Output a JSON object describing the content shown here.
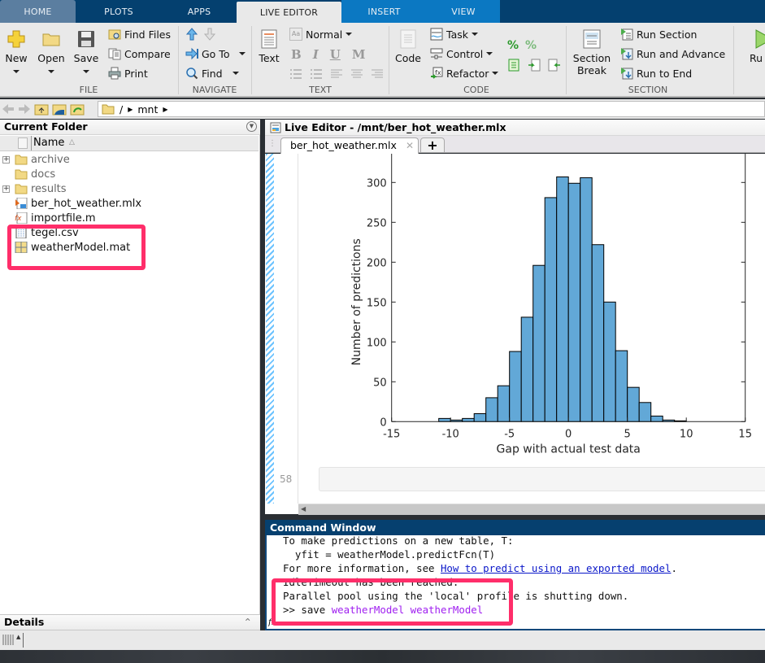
{
  "ribbon": {
    "tabs": [
      {
        "label": "HOME",
        "state": "inactive"
      },
      {
        "label": "PLOTS",
        "state": "inactive"
      },
      {
        "label": "APPS",
        "state": "inactive"
      },
      {
        "label": "LIVE EDITOR",
        "state": "active"
      },
      {
        "label": "INSERT",
        "state": "inactive"
      },
      {
        "label": "VIEW",
        "state": "inactive"
      }
    ],
    "file": {
      "group_label": "FILE",
      "new_label": "New",
      "open_label": "Open",
      "save_label": "Save",
      "find_files_label": "Find Files",
      "compare_label": "Compare",
      "print_label": "Print"
    },
    "navigate": {
      "group_label": "NAVIGATE",
      "goto_label": "Go To",
      "find_label": "Find"
    },
    "text": {
      "group_label": "TEXT",
      "text_label": "Text",
      "style_select": "Normal",
      "bold": "B",
      "italic": "I",
      "underline": "U",
      "monospace": "M"
    },
    "code": {
      "group_label": "CODE",
      "code_label": "Code",
      "task_label": "Task",
      "control_label": "Control",
      "refactor_label": "Refactor"
    },
    "section": {
      "group_label": "SECTION",
      "section_break_line1": "Section",
      "section_break_line2": "Break",
      "run_section_label": "Run Section",
      "run_advance_label": "Run and Advance",
      "run_end_label": "Run to End"
    },
    "run_label": "Ru"
  },
  "address": {
    "path_root": "/",
    "path_segments": [
      "mnt"
    ]
  },
  "current_folder": {
    "title": "Current Folder",
    "column_name": "Name",
    "sort_indicator": "△",
    "items": [
      {
        "name": "archive",
        "type": "folder",
        "expandable": true
      },
      {
        "name": "docs",
        "type": "folder",
        "expandable": false
      },
      {
        "name": "results",
        "type": "folder",
        "expandable": true
      },
      {
        "name": "ber_hot_weather.mlx",
        "type": "live-script",
        "expandable": false
      },
      {
        "name": "importfile.m",
        "type": "function",
        "expandable": false
      },
      {
        "name": "tegel.csv",
        "type": "csv",
        "expandable": false
      },
      {
        "name": "weatherModel.mat",
        "type": "mat",
        "expandable": false
      }
    ]
  },
  "details": {
    "title": "Details"
  },
  "live_editor": {
    "title": "Live Editor - /mnt/ber_hot_weather.mlx",
    "tab_label": "ber_hot_weather.mlx",
    "new_tab": "+",
    "line_number": "58"
  },
  "chart_data": {
    "type": "bar",
    "subtype": "histogram",
    "title": "",
    "xlabel": "Gap with actual test data",
    "ylabel": "Number of predictions",
    "xlim": [
      -15,
      15
    ],
    "ylim_visible": [
      0,
      320
    ],
    "xticks": [
      -15,
      -10,
      -5,
      0,
      5,
      10,
      15
    ],
    "yticks": [
      0,
      50,
      100,
      150,
      200,
      250,
      300
    ],
    "bin_edges": [
      -11,
      -10,
      -9,
      -8,
      -7,
      -6,
      -5,
      -4,
      -3,
      -2,
      -1,
      0,
      1,
      2,
      3,
      4,
      5,
      6,
      7,
      8,
      9,
      10
    ],
    "values": [
      4,
      2,
      4,
      10,
      30,
      45,
      88,
      131,
      196,
      281,
      307,
      299,
      306,
      222,
      150,
      89,
      43,
      24,
      7,
      2,
      1
    ],
    "bar_color": "#62a8d7",
    "edge_color": "#000000",
    "grid": false
  },
  "command_window": {
    "title": "Command Window",
    "lines": [
      {
        "text": "To make predictions on a new table, T:"
      },
      {
        "text": "  yfit = weatherModel.predictFcn(T)"
      },
      {
        "prefix": "For more information, see ",
        "link": "How to predict using an exported model",
        "suffix": "."
      },
      {
        "text": "IdleTimeout has been reached."
      },
      {
        "text": "Parallel pool using the 'local' profile is shutting down."
      },
      {
        "prompt": ">> ",
        "command": "save ",
        "args": "weatherModel weatherModel"
      }
    ],
    "fx_symbol": "fx"
  },
  "annotations": {
    "color": "#ff2e6a"
  }
}
